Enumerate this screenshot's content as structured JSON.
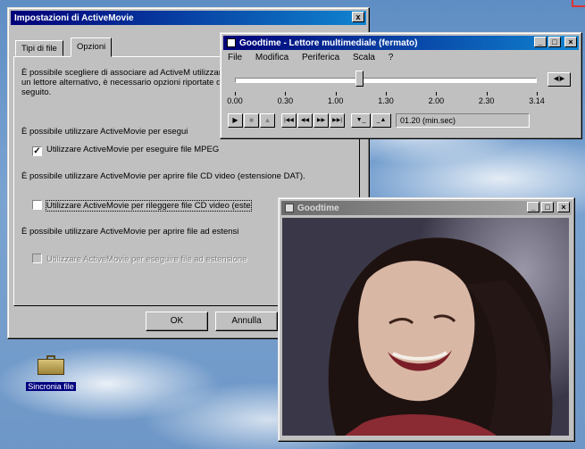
{
  "settings_window": {
    "title": "Impostazioni di ActiveMovie",
    "close_glyph": "x",
    "tabs": [
      {
        "label": "Tipi di file"
      },
      {
        "label": "Opzioni"
      }
    ],
    "intro_text": "È possibile scegliere di associare ad ActiveM utilizzare un lettore alternativo, è necessario opzioni riportate di seguito.",
    "section1_text": "È possibile utilizzare ActiveMovie per esegui",
    "checkbox1_label": "Utilizzare ActiveMovie per eseguire file MPEG",
    "checkbox1_checked": true,
    "section2_text": "È possibile utilizzare ActiveMovie per aprire file CD video (estensione DAT).",
    "checkbox2_label": "Utilizzare ActiveMovie per rileggere file CD  video (este",
    "checkbox2_checked": false,
    "section3_text": "È possibile utilizzare ActiveMovie per aprire file ad estensi",
    "checkbox3_label": "Utilizzare ActiveMovie per eseguire file ad estensione",
    "checkbox3_enabled": false,
    "ok_label": "OK",
    "cancel_label": "Annulla"
  },
  "player_window": {
    "title": "Goodtime - Lettore multimediale (fermato)",
    "menu": [
      "File",
      "Modifica",
      "Periferica",
      "Scala",
      "?"
    ],
    "ticks": [
      "0.00",
      "0.30",
      "1.00",
      "1.30",
      "2.00",
      "2.30",
      "3.14"
    ],
    "position_fraction": 0.41,
    "time_display": "01.20 (min.sec)",
    "buttons": {
      "play": "▶",
      "stop": "■",
      "eject": "▲",
      "prev_mark": "|◀◀",
      "rewind": "◀◀",
      "forward": "▶▶",
      "next_mark": "▶▶|",
      "mark_in": "▼_",
      "mark_out": "_▲",
      "scroll": "◀|▶"
    }
  },
  "video_window": {
    "title": "Goodtime"
  },
  "desktop_icon": {
    "label": "Sincronia file"
  }
}
